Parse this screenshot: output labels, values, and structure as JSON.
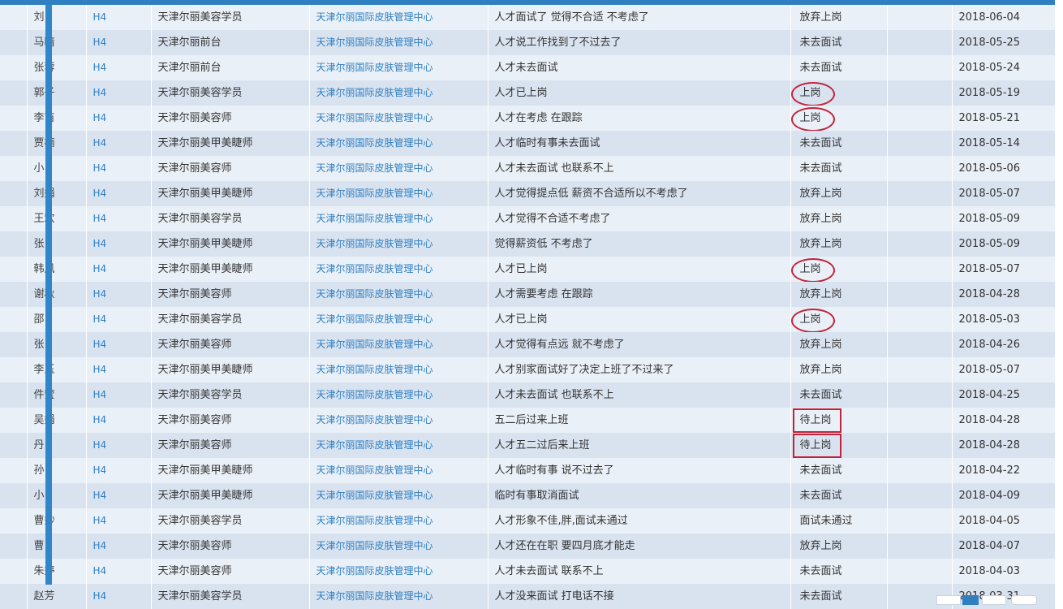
{
  "colors": {
    "accent": "#2f7fc1",
    "highlight": "#c2233a",
    "row_odd": "#eaf0f7",
    "row_even": "#d9e3f0"
  },
  "rows": [
    {
      "name": "刘",
      "level": "H4",
      "position": "天津尔丽美容学员",
      "org": "天津尔丽国际皮肤管理中心",
      "note": "人才面试了 觉得不合适 不考虑了",
      "status": "放弃上岗",
      "mark": "",
      "date": "2018-06-04"
    },
    {
      "name": "马晴",
      "level": "H4",
      "position": "天津尔丽前台",
      "org": "天津尔丽国际皮肤管理中心",
      "note": "人才说工作找到了不过去了",
      "status": "未去面试",
      "mark": "",
      "date": "2018-05-25"
    },
    {
      "name": "张蓉",
      "level": "H4",
      "position": "天津尔丽前台",
      "org": "天津尔丽国际皮肤管理中心",
      "note": "人才未去面试",
      "status": "未去面试",
      "mark": "",
      "date": "2018-05-24"
    },
    {
      "name": "郭子",
      "level": "H4",
      "position": "天津尔丽美容学员",
      "org": "天津尔丽国际皮肤管理中心",
      "note": "人才已上岗",
      "status": "上岗",
      "mark": "circle",
      "date": "2018-05-19"
    },
    {
      "name": "李苗",
      "level": "H4",
      "position": "天津尔丽美容师",
      "org": "天津尔丽国际皮肤管理中心",
      "note": "人才在考虑 在跟踪",
      "status": "上岗",
      "mark": "circle",
      "date": "2018-05-21"
    },
    {
      "name": "贾楠",
      "level": "H4",
      "position": "天津尔丽美甲美睫师",
      "org": "天津尔丽国际皮肤管理中心",
      "note": "人才临时有事未去面试",
      "status": "未去面试",
      "mark": "",
      "date": "2018-05-14"
    },
    {
      "name": "小",
      "level": "H4",
      "position": "天津尔丽美容师",
      "org": "天津尔丽国际皮肤管理中心",
      "note": "人才未去面试 也联系不上",
      "status": "未去面试",
      "mark": "",
      "date": "2018-05-06"
    },
    {
      "name": "刘娟",
      "level": "H4",
      "position": "天津尔丽美甲美睫师",
      "org": "天津尔丽国际皮肤管理中心",
      "note": "人才觉得提点低 薪资不合适所以不考虑了",
      "status": "放弃上岗",
      "mark": "",
      "date": "2018-05-07"
    },
    {
      "name": "王欢",
      "level": "H4",
      "position": "天津尔丽美容学员",
      "org": "天津尔丽国际皮肤管理中心",
      "note": "人才觉得不合适不考虑了",
      "status": "放弃上岗",
      "mark": "",
      "date": "2018-05-09"
    },
    {
      "name": "张",
      "level": "H4",
      "position": "天津尔丽美甲美睫师",
      "org": "天津尔丽国际皮肤管理中心",
      "note": "觉得薪资低 不考虑了",
      "status": "放弃上岗",
      "mark": "",
      "date": "2018-05-09"
    },
    {
      "name": "韩风",
      "level": "H4",
      "position": "天津尔丽美甲美睫师",
      "org": "天津尔丽国际皮肤管理中心",
      "note": "人才已上岗",
      "status": "上岗",
      "mark": "circle",
      "date": "2018-05-07"
    },
    {
      "name": "谢秋",
      "level": "H4",
      "position": "天津尔丽美容师",
      "org": "天津尔丽国际皮肤管理中心",
      "note": "人才需要考虑 在跟踪",
      "status": "放弃上岗",
      "mark": "",
      "date": "2018-04-28"
    },
    {
      "name": "邵",
      "level": "H4",
      "position": "天津尔丽美容学员",
      "org": "天津尔丽国际皮肤管理中心",
      "note": "人才已上岗",
      "status": "上岗",
      "mark": "circle",
      "date": "2018-05-03"
    },
    {
      "name": "张",
      "level": "H4",
      "position": "天津尔丽美容师",
      "org": "天津尔丽国际皮肤管理中心",
      "note": "人才觉得有点远 就不考虑了",
      "status": "放弃上岗",
      "mark": "",
      "date": "2018-04-26"
    },
    {
      "name": "李玉",
      "level": "H4",
      "position": "天津尔丽美甲美睫师",
      "org": "天津尔丽国际皮肤管理中心",
      "note": "人才别家面试好了决定上班了不过来了",
      "status": "放弃上岗",
      "mark": "",
      "date": "2018-05-07"
    },
    {
      "name": "件莹",
      "level": "H4",
      "position": "天津尔丽美容学员",
      "org": "天津尔丽国际皮肤管理中心",
      "note": "人才未去面试 也联系不上",
      "status": "未去面试",
      "mark": "",
      "date": "2018-04-25"
    },
    {
      "name": "吴娟",
      "level": "H4",
      "position": "天津尔丽美容师",
      "org": "天津尔丽国际皮肤管理中心",
      "note": "五二后过来上班",
      "status": "待上岗",
      "mark": "box",
      "date": "2018-04-28"
    },
    {
      "name": "丹",
      "level": "H4",
      "position": "天津尔丽美容师",
      "org": "天津尔丽国际皮肤管理中心",
      "note": "人才五二过后来上班",
      "status": "待上岗",
      "mark": "box",
      "date": "2018-04-28"
    },
    {
      "name": "孙",
      "level": "H4",
      "position": "天津尔丽美甲美睫师",
      "org": "天津尔丽国际皮肤管理中心",
      "note": "人才临时有事 说不过去了",
      "status": "未去面试",
      "mark": "",
      "date": "2018-04-22"
    },
    {
      "name": "小",
      "level": "H4",
      "position": "天津尔丽美甲美睫师",
      "org": "天津尔丽国际皮肤管理中心",
      "note": "临时有事取消面试",
      "status": "未去面试",
      "mark": "",
      "date": "2018-04-09"
    },
    {
      "name": "曹妙",
      "level": "H4",
      "position": "天津尔丽美容学员",
      "org": "天津尔丽国际皮肤管理中心",
      "note": "人才形象不佳,胖,面试未通过",
      "status": "面试未通过",
      "mark": "",
      "date": "2018-04-05"
    },
    {
      "name": "曹",
      "level": "H4",
      "position": "天津尔丽美容师",
      "org": "天津尔丽国际皮肤管理中心",
      "note": "人才还在在职 要四月底才能走",
      "status": "放弃上岗",
      "mark": "",
      "date": "2018-04-07"
    },
    {
      "name": "朱婷",
      "level": "H4",
      "position": "天津尔丽美容师",
      "org": "天津尔丽国际皮肤管理中心",
      "note": "人才未去面试 联系不上",
      "status": "未去面试",
      "mark": "",
      "date": "2018-04-03"
    },
    {
      "name": "赵芳",
      "level": "H4",
      "position": "天津尔丽美容学员",
      "org": "天津尔丽国际皮肤管理中心",
      "note": "人才没来面试 打电话不接",
      "status": "未去面试",
      "mark": "",
      "date": "2018-03-31"
    }
  ]
}
